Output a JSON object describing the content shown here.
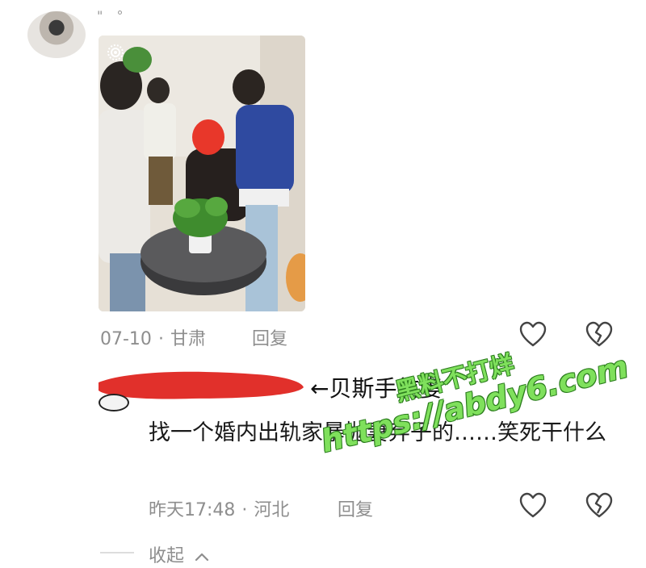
{
  "comment1": {
    "username": "\" °",
    "date": "07-10",
    "location": "甘肃",
    "reply_label": "回复"
  },
  "comment2": {
    "annotation": "←贝斯手前妻",
    "text": "找一个婚内出轨家暴抛妻弃子的……笑死干什么",
    "time": "昨天17:48",
    "location": "河北",
    "reply_label": "回复"
  },
  "collapse_label": "收起",
  "separator": "·",
  "watermark": {
    "line1": "黑料不打烊",
    "url": "https://abdy6.com"
  },
  "icons": {
    "like": "heart-outline-icon",
    "dislike": "broken-heart-icon",
    "collapse": "chevron-up-icon"
  }
}
